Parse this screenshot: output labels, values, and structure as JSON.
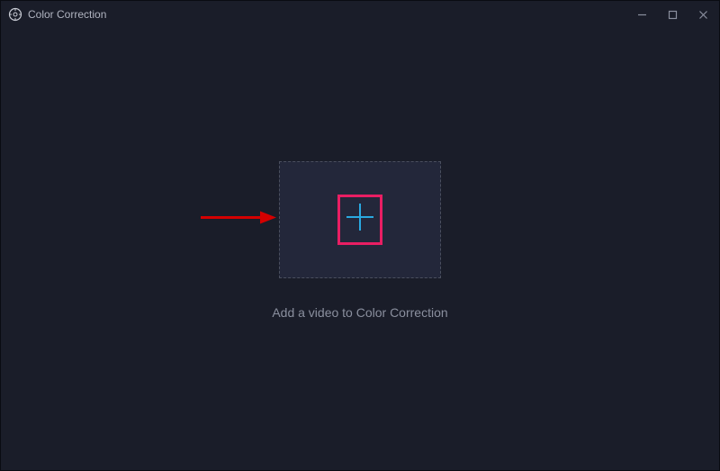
{
  "window": {
    "title": "Color Correction"
  },
  "main": {
    "hint": "Add a video to Color Correction"
  },
  "colors": {
    "accent_highlight": "#e91e63",
    "plus_icon": "#2aa9e0",
    "annotation_arrow": "#d40000"
  }
}
